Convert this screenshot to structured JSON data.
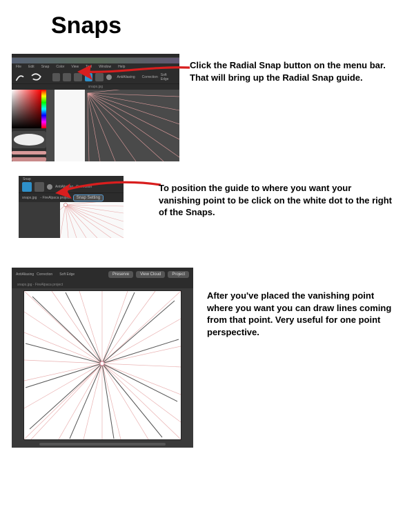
{
  "title": "Snaps",
  "captions": {
    "c1": "Click the Radial Snap button on the menu bar. That will bring up the Radial Snap guide.",
    "c2": "To position the guide to where you want your vanishing point to be click on the white dot to the right of the Snaps.",
    "c3": "After you've placed the vanishing point where you want you can draw lines coming from that point. Very useful for one point perspective."
  },
  "app": {
    "menus": [
      "File",
      "Edit",
      "Snap",
      "Color",
      "View",
      "Tool",
      "Window",
      "Help"
    ],
    "toolbar": {
      "antialias_label": "AntiAliasing",
      "correction_label": "Correction",
      "softedge_label": "Soft Edge"
    },
    "tab_label": "snaps.jpg",
    "project_suffix": "- FireAlpaca project"
  },
  "snap_panel": {
    "heading": "Snap",
    "setting_btn": "Snap Setting"
  },
  "screenshot3": {
    "pills": [
      "Preserve",
      "View Cloud",
      "Project"
    ],
    "softedge": "Soft Edge"
  }
}
